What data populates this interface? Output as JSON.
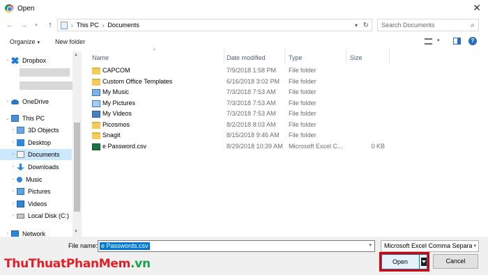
{
  "window": {
    "title": "Open",
    "close_glyph": "✕"
  },
  "nav": {
    "breadcrumb": [
      "This PC",
      "Documents"
    ],
    "search_placeholder": "Search Documents"
  },
  "toolbar": {
    "organize": "Organize",
    "new_folder": "New folder"
  },
  "sidebar": {
    "items": [
      {
        "label": "Dropbox",
        "icon": "dropbox-icon"
      },
      {
        "label": "OneDrive",
        "icon": "onedrive-icon"
      },
      {
        "label": "This PC",
        "icon": "this-pc-icon"
      },
      {
        "label": "3D Objects",
        "icon": "3d-objects-icon"
      },
      {
        "label": "Desktop",
        "icon": "desktop-icon"
      },
      {
        "label": "Documents",
        "icon": "documents-icon",
        "selected": true
      },
      {
        "label": "Downloads",
        "icon": "downloads-icon"
      },
      {
        "label": "Music",
        "icon": "music-icon"
      },
      {
        "label": "Pictures",
        "icon": "pictures-icon"
      },
      {
        "label": "Videos",
        "icon": "videos-icon"
      },
      {
        "label": "Local Disk (C:)",
        "icon": "disk-icon"
      },
      {
        "label": "Network",
        "icon": "network-icon"
      }
    ]
  },
  "columns": {
    "name": "Name",
    "date": "Date modified",
    "type": "Type",
    "size": "Size"
  },
  "files": [
    {
      "name": "CAPCOM",
      "date": "7/9/2018 1:58 PM",
      "type": "File folder",
      "size": "",
      "icon": "folder-icon"
    },
    {
      "name": "Custom Office Templates",
      "date": "6/16/2018 3:02 PM",
      "type": "File folder",
      "size": "",
      "icon": "folder-icon"
    },
    {
      "name": "My Music",
      "date": "7/3/2018 7:53 AM",
      "type": "File folder",
      "size": "",
      "icon": "music-folder-icon"
    },
    {
      "name": "My Pictures",
      "date": "7/3/2018 7:53 AM",
      "type": "File folder",
      "size": "",
      "icon": "pictures-folder-icon"
    },
    {
      "name": "My Videos",
      "date": "7/3/2018 7:53 AM",
      "type": "File folder",
      "size": "",
      "icon": "videos-folder-icon"
    },
    {
      "name": "Picosmos",
      "date": "8/2/2018 8:03 AM",
      "type": "File folder",
      "size": "",
      "icon": "folder-icon"
    },
    {
      "name": "Snagit",
      "date": "8/15/2018 9:46 AM",
      "type": "File folder",
      "size": "",
      "icon": "folder-icon"
    },
    {
      "name": "e Password.csv",
      "date": "8/29/2018 10:39 AM",
      "type": "Microsoft Excel C...",
      "size": "0 KB",
      "icon": "excel-csv-icon"
    }
  ],
  "footer": {
    "file_name_label": "File name:",
    "file_name_value": "e Passwords.csv",
    "file_type": "Microsoft Excel Comma Separa",
    "open": "Open",
    "cancel": "Cancel"
  },
  "watermark": {
    "part1": "ThuThuat",
    "part2": "PhanMem",
    "part3": ".vn"
  },
  "colors": {
    "accent": "#0078d7",
    "selection": "#cce8ff",
    "highlight_border": "#e00000",
    "watermark_red": "#e21e26",
    "watermark_green": "#17a34a"
  }
}
